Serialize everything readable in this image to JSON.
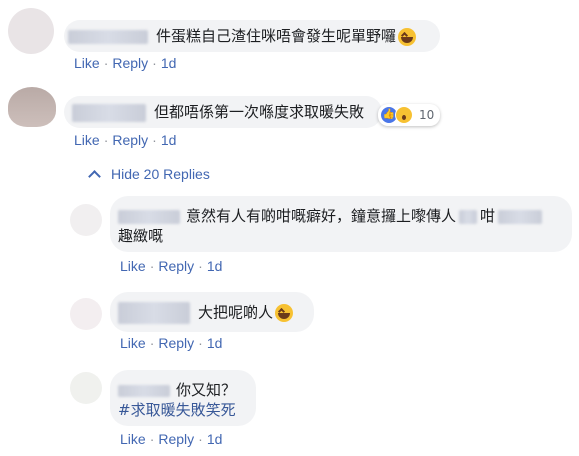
{
  "comments": [
    {
      "text": "件蛋糕自己渣住咪唔會發生呢單野囉",
      "actions": {
        "like": "Like",
        "reply": "Reply",
        "time": "1d"
      }
    },
    {
      "text": "但都唔係第一次喺度求取暖失敗",
      "reactions": {
        "count": "10"
      },
      "actions": {
        "like": "Like",
        "reply": "Reply",
        "time": "1d"
      }
    }
  ],
  "hide_replies": {
    "label": "Hide 20 Replies"
  },
  "replies": [
    {
      "line1": "意然有人有啲咁嘅癖好，鐘意攞上嚟傳人",
      "line1_b": "咁",
      "line2": "趣緻嘅",
      "actions": {
        "like": "Like",
        "reply": "Reply",
        "time": "1d"
      }
    },
    {
      "text": "大把呢啲人",
      "actions": {
        "like": "Like",
        "reply": "Reply",
        "time": "1d"
      }
    },
    {
      "line1": "你又知？",
      "hashtag": "#求取暖失敗笑死",
      "actions": {
        "like": "Like",
        "reply": "Reply",
        "time": "1d"
      }
    }
  ],
  "colors": {
    "link": "#4267b2",
    "bubble": "#f2f3f5",
    "hashtag": "#385898"
  }
}
